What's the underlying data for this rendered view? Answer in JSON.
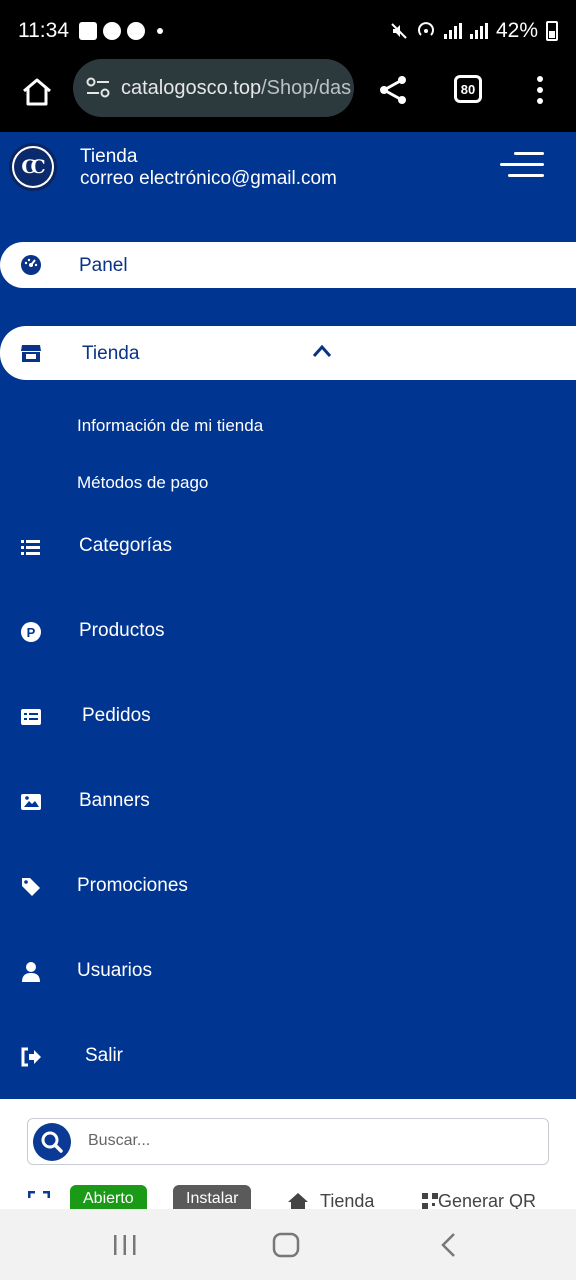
{
  "status_bar": {
    "time": "11:34",
    "battery": "42%"
  },
  "browser": {
    "url_host": "catalogosco.top",
    "url_path": "/Shop/das",
    "tab_count": "80"
  },
  "drawer": {
    "logo_letters": "CC",
    "store_name": "Tienda",
    "store_email": "correo electrónico@gmail.com"
  },
  "menu": {
    "panel": "Panel",
    "tienda": "Tienda",
    "tienda_sub": [
      "Información de mi tienda",
      "Métodos de pago"
    ],
    "items": [
      "Categorías",
      "Productos",
      "Pedidos",
      "Banners",
      "Promociones",
      "Usuarios",
      "Salir"
    ]
  },
  "bottom": {
    "search_placeholder": "Buscar...",
    "open_label": "Abierto",
    "install_label": "Instalar",
    "store_link": "Tienda",
    "qr_link": "Generar QR"
  },
  "colors": {
    "drawer_bg": "#003592",
    "active_text": "#0a3286",
    "open_chip": "#1a9a17"
  }
}
